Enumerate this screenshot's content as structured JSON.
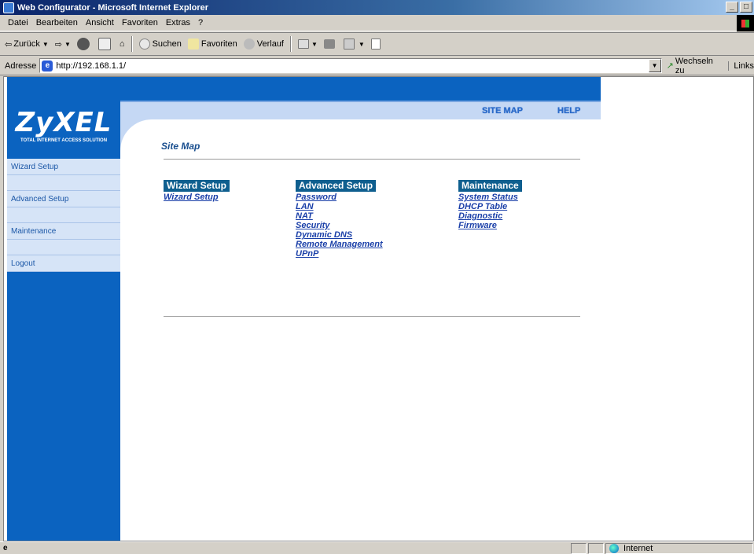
{
  "window": {
    "title": "Web Configurator - Microsoft Internet Explorer",
    "buttons": [
      "_",
      "□"
    ]
  },
  "menu": [
    "Datei",
    "Bearbeiten",
    "Ansicht",
    "Favoriten",
    "Extras",
    "?"
  ],
  "toolbar": {
    "back": "Zurück",
    "search": "Suchen",
    "favorites": "Favoriten",
    "history": "Verlauf"
  },
  "address": {
    "label": "Adresse",
    "url": "http://192.168.1.1/",
    "go": "Wechseln zu",
    "links": "Links"
  },
  "logo": {
    "name": "ZyXEL",
    "tagline": "TOTAL INTERNET ACCESS SOLUTION"
  },
  "sidebar": {
    "items": [
      "Wizard Setup",
      "Advanced Setup",
      "Maintenance",
      "Logout"
    ]
  },
  "header_links": {
    "site_map": "SITE MAP",
    "help": "HELP"
  },
  "page": {
    "title": "Site Map"
  },
  "columns": [
    {
      "heading": "Wizard Setup",
      "links": [
        "Wizard Setup"
      ]
    },
    {
      "heading": "Advanced Setup",
      "links": [
        "Password",
        "LAN",
        "NAT",
        "Security",
        "Dynamic DNS",
        "Remote Management",
        "UPnP"
      ]
    },
    {
      "heading": "Maintenance",
      "links": [
        "System Status",
        "DHCP Table",
        "Diagnostic",
        "Firmware"
      ]
    }
  ],
  "status": {
    "zone": "Internet"
  }
}
